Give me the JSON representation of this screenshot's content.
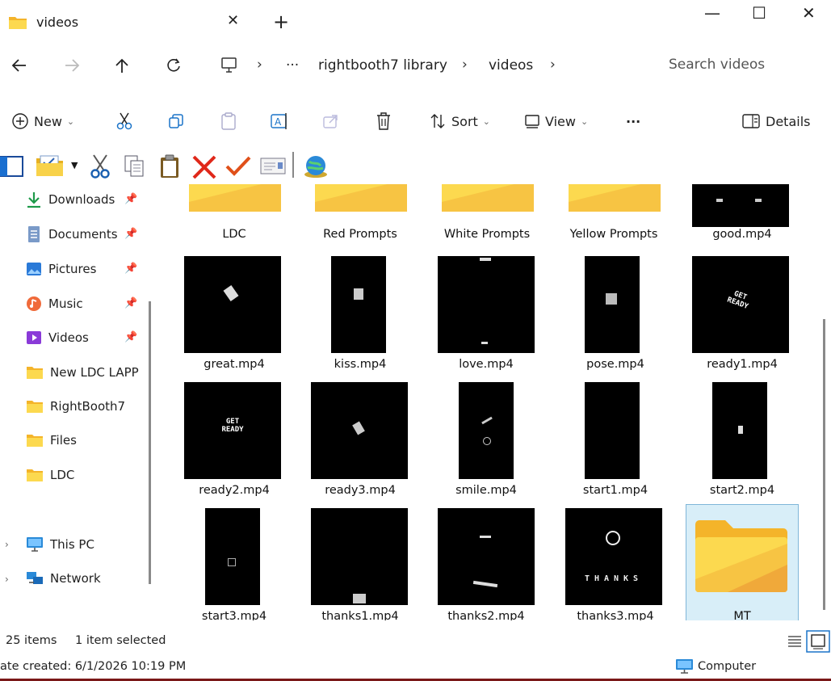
{
  "window": {
    "tab_title": "videos",
    "tab_icon": "folder-icon",
    "minimize": "—",
    "maximize": "☐",
    "close": "✕"
  },
  "address": {
    "breadcrumbs": [
      "rightbooth7 library",
      "videos"
    ],
    "more": "···",
    "search_placeholder": "Search videos"
  },
  "commands": {
    "new_label": "New",
    "sort_label": "Sort",
    "view_label": "View",
    "more": "···",
    "details_label": "Details"
  },
  "sidebar": {
    "items": [
      {
        "label": "Downloads",
        "icon": "download-icon",
        "pinned": true
      },
      {
        "label": "Documents",
        "icon": "documents-icon",
        "pinned": true
      },
      {
        "label": "Pictures",
        "icon": "pictures-icon",
        "pinned": true
      },
      {
        "label": "Music",
        "icon": "music-icon",
        "pinned": true
      },
      {
        "label": "Videos",
        "icon": "videos-icon",
        "pinned": true
      },
      {
        "label": "New LDC LAPP",
        "icon": "folder-icon",
        "pinned": false
      },
      {
        "label": "RightBooth7",
        "icon": "folder-icon",
        "pinned": false
      },
      {
        "label": "Files",
        "icon": "folder-icon",
        "pinned": false
      },
      {
        "label": "LDC",
        "icon": "folder-icon",
        "pinned": false
      },
      {
        "label": "This PC",
        "icon": "computer-icon",
        "pinned": false
      },
      {
        "label": "Network",
        "icon": "network-icon",
        "pinned": false
      }
    ]
  },
  "files": [
    {
      "name": "LDC",
      "type": "folder"
    },
    {
      "name": "Red Prompts",
      "type": "folder"
    },
    {
      "name": "White Prompts",
      "type": "folder"
    },
    {
      "name": "Yellow Prompts",
      "type": "folder"
    },
    {
      "name": "good.mp4",
      "type": "video"
    },
    {
      "name": "great.mp4",
      "type": "video"
    },
    {
      "name": "kiss.mp4",
      "type": "video"
    },
    {
      "name": "love.mp4",
      "type": "video"
    },
    {
      "name": "pose.mp4",
      "type": "video"
    },
    {
      "name": "ready1.mp4",
      "type": "video",
      "overlay": "GET READY"
    },
    {
      "name": "ready2.mp4",
      "type": "video",
      "overlay": "GET READY"
    },
    {
      "name": "ready3.mp4",
      "type": "video"
    },
    {
      "name": "smile.mp4",
      "type": "video"
    },
    {
      "name": "start1.mp4",
      "type": "video"
    },
    {
      "name": "start2.mp4",
      "type": "video"
    },
    {
      "name": "start3.mp4",
      "type": "video"
    },
    {
      "name": "thanks1.mp4",
      "type": "video"
    },
    {
      "name": "thanks2.mp4",
      "type": "video"
    },
    {
      "name": "thanks3.mp4",
      "type": "video",
      "overlay": "THANKS"
    },
    {
      "name": "MT",
      "type": "folder",
      "selected": true
    }
  ],
  "status": {
    "item_count": "25 items",
    "selection": "1 item selected",
    "date_created": "ate created: 6/1/2026 10:19 PM",
    "computer": "Computer"
  },
  "colors": {
    "folder_yellow": "#fcd94f",
    "folder_dark": "#f4b42a",
    "selection_bg": "#d8eef8",
    "accent_blue": "#1a73c8",
    "window_border": "#7a1818"
  }
}
